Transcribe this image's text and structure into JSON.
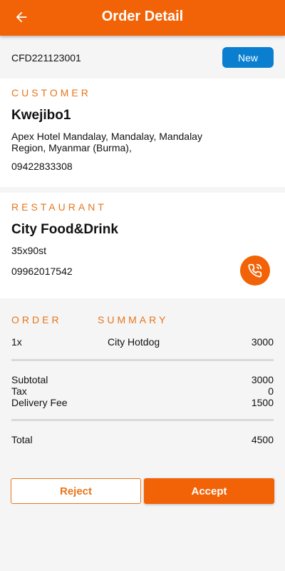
{
  "colors": {
    "primary": "#f26207",
    "accent_text": "#e8751a",
    "badge": "#0a7fd0"
  },
  "header": {
    "title": "Order Detail",
    "back_icon": "arrow-left-icon"
  },
  "order": {
    "id": "CFD221123001",
    "status": "New"
  },
  "customer": {
    "section_label": "CUSTOMER",
    "name": "Kwejibo1",
    "address_line1": "Apex Hotel Mandalay, Mandalay, Mandalay",
    "address_line2": "Region, Myanmar (Burma),",
    "phone": "09422833308"
  },
  "restaurant": {
    "section_label": "RESTAURANT",
    "name": "City Food&Drink",
    "address": "35x90st",
    "phone": "09962017542",
    "call_icon": "phone-call-icon"
  },
  "summary": {
    "label_left": "ORDER",
    "label_right": "SUMMARY",
    "items": [
      {
        "qty": "1x",
        "name": "City Hotdog",
        "price": "3000"
      }
    ],
    "subtotal_label": "Subtotal",
    "subtotal": "3000",
    "tax_label": "Tax",
    "tax": "0",
    "delivery_label": "Delivery Fee",
    "delivery": "1500",
    "total_label": "Total",
    "total": "4500"
  },
  "actions": {
    "reject": "Reject",
    "accept": "Accept"
  }
}
